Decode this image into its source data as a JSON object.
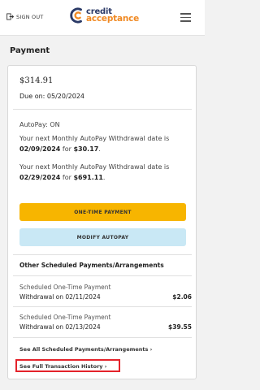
{
  "header": {
    "sign_out_label": "SIGN OUT",
    "logo_line1": "credit",
    "logo_line2": "acceptance",
    "menu_icon": "hamburger-menu-icon"
  },
  "page": {
    "title": "Payment"
  },
  "payment": {
    "amount": "$314.91",
    "due_text": "Due on: 05/20/2024",
    "autopay_status": "AutoPay: ON",
    "autopay_1": {
      "prefix": "Your next Monthly AutoPay Withdrawal date is ",
      "date": "02/09/2024",
      "mid": " for ",
      "amount": "$30.17",
      "suffix": "."
    },
    "autopay_2": {
      "prefix": "Your next Monthly AutoPay Withdrawal date is ",
      "date": "02/29/2024",
      "mid": " for ",
      "amount": "$691.11",
      "suffix": "."
    },
    "one_time_button": "ONE-TIME PAYMENT",
    "modify_button": "MODIFY AUTOPAY"
  },
  "scheduled": {
    "section_title": "Other Scheduled Payments/Arrangements",
    "items": [
      {
        "title": "Scheduled One-Time Payment",
        "withdrawal": "Withdrawal on 02/11/2024",
        "amount": "$2.06"
      },
      {
        "title": "Scheduled One-Time Payment",
        "withdrawal": "Withdrawal on 02/13/2024",
        "amount": "$39.55"
      }
    ],
    "see_all_link": "See All Scheduled Payments/Arrangements ›",
    "history_link": "See Full Transaction History ›"
  },
  "colors": {
    "brand_navy": "#2b3a67",
    "brand_orange": "#f08a24",
    "primary_button": "#f7b500",
    "secondary_button": "#c9e8f5",
    "highlight_border": "#e4232b"
  }
}
